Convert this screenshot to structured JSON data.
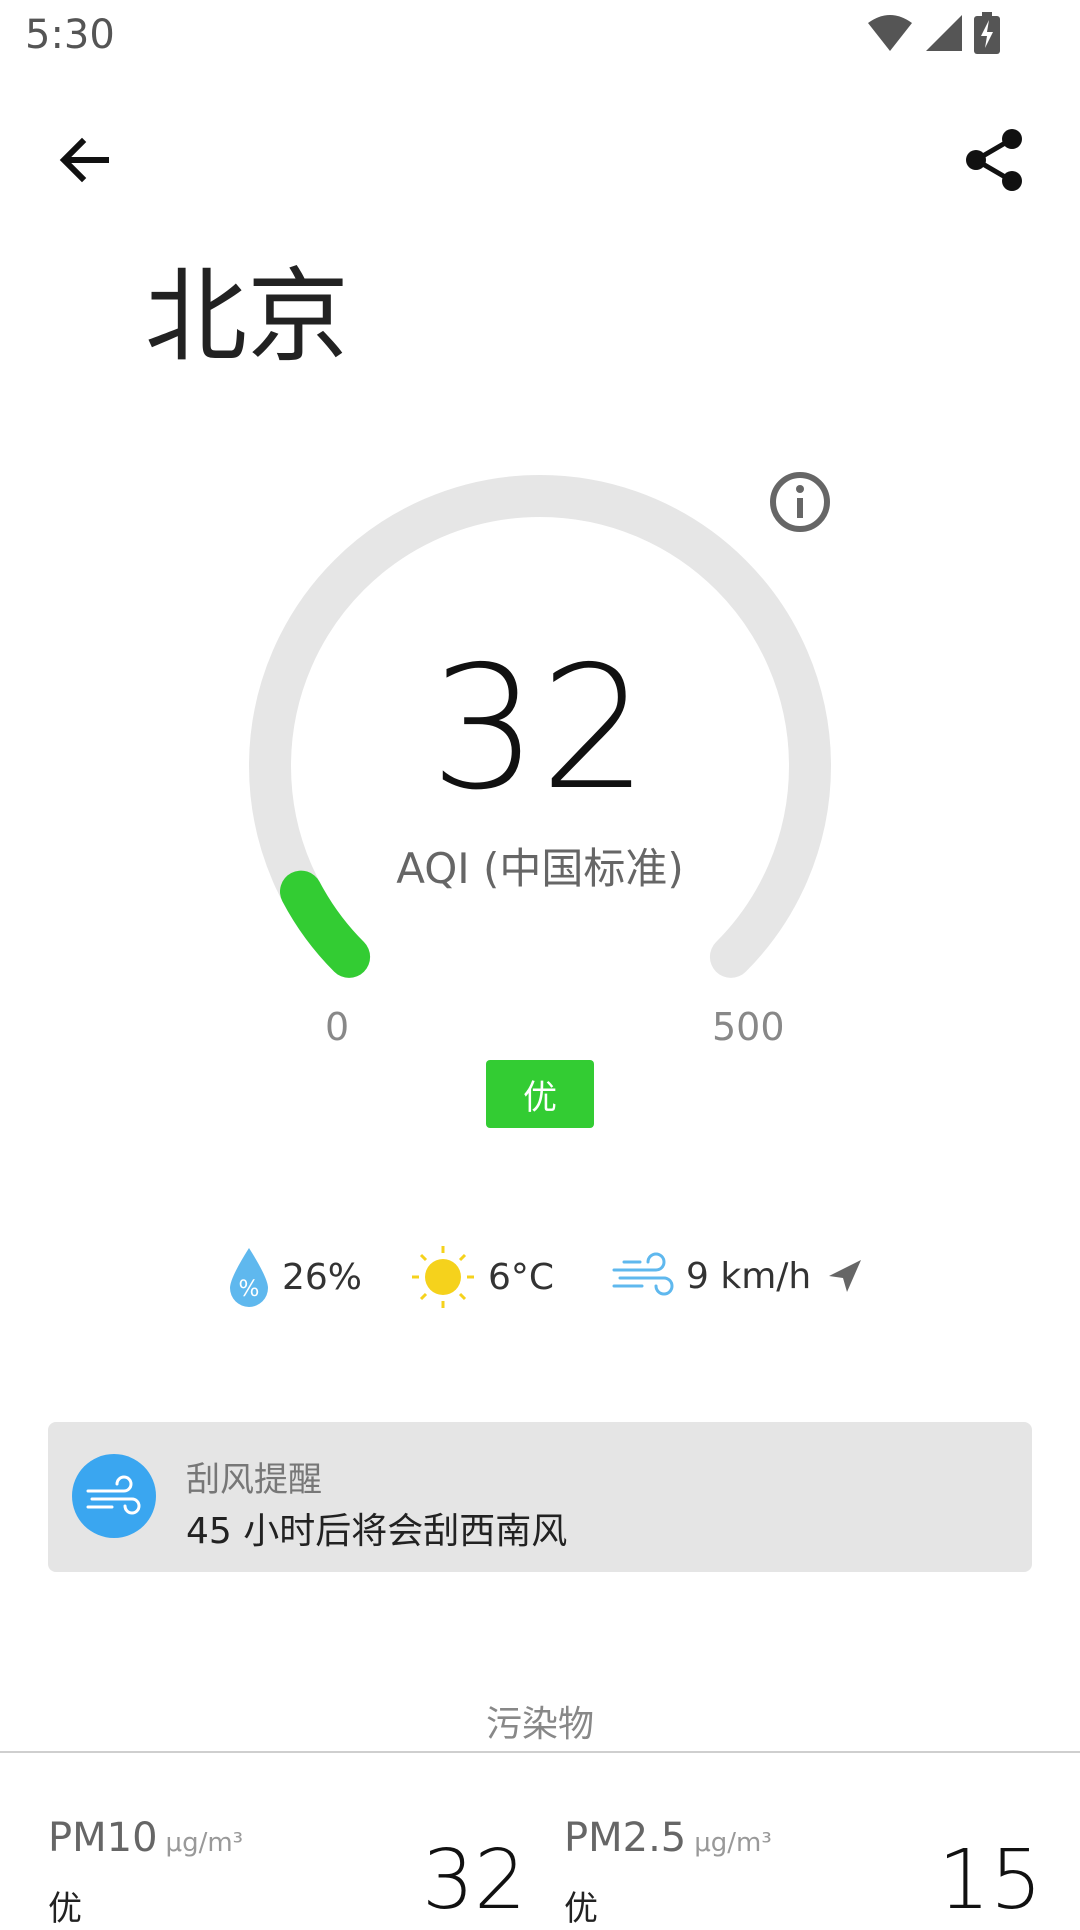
{
  "status_bar": {
    "time": "5:30",
    "icons": [
      "wifi-icon",
      "cell-signal-icon",
      "battery-charging-icon"
    ]
  },
  "toolbar": {
    "back_icon": "arrow-left-icon",
    "share_icon": "share-icon"
  },
  "city": "北京",
  "aqi": {
    "value": "32",
    "label": "AQI (中国标准)",
    "scale_min": "0",
    "scale_max": "500",
    "level": "优",
    "level_color": "#33cc33",
    "track_color": "#e6e6e6",
    "fraction": 0.064
  },
  "weather": {
    "humidity": "26%",
    "temperature": "6°C",
    "wind": "9 km/h",
    "humidity_icon": "humidity-drop-icon",
    "sun_icon": "sun-icon",
    "wind_icon": "wind-icon",
    "direction_icon": "wind-direction-icon"
  },
  "alert": {
    "icon": "wind-icon",
    "title": "刮风提醒",
    "text": "45 小时后将会刮西南风"
  },
  "pollutants": {
    "section_title": "污染物",
    "items": [
      {
        "name": "PM10",
        "unit": "μg/m³",
        "level": "优",
        "value": "32"
      },
      {
        "name": "PM2.5",
        "unit": "μg/m³",
        "level": "优",
        "value": "15"
      }
    ]
  }
}
